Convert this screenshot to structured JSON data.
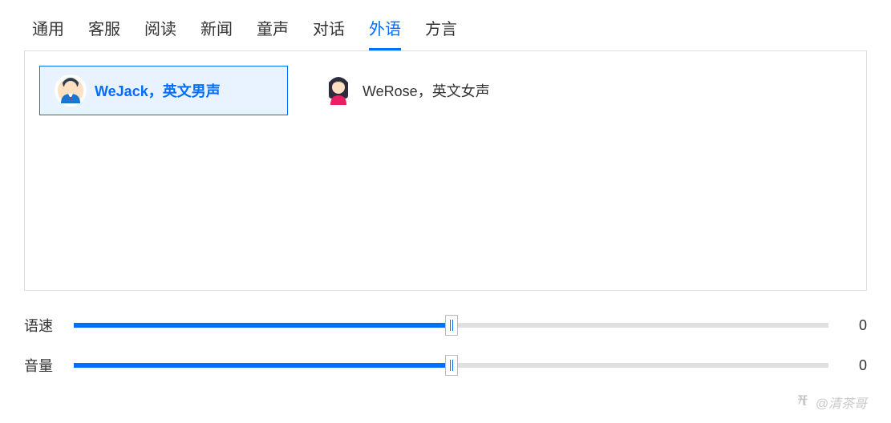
{
  "tabs": [
    {
      "label": "通用",
      "active": false
    },
    {
      "label": "客服",
      "active": false
    },
    {
      "label": "阅读",
      "active": false
    },
    {
      "label": "新闻",
      "active": false
    },
    {
      "label": "童声",
      "active": false
    },
    {
      "label": "对话",
      "active": false
    },
    {
      "label": "外语",
      "active": true
    },
    {
      "label": "方言",
      "active": false
    }
  ],
  "voices": [
    {
      "label": "WeJack，英文男声",
      "selected": true,
      "gender": "male"
    },
    {
      "label": "WeRose，英文女声",
      "selected": false,
      "gender": "female"
    }
  ],
  "sliders": {
    "speed": {
      "label": "语速",
      "percent": 50,
      "value": "0"
    },
    "volume": {
      "label": "音量",
      "percent": 50,
      "value": "0"
    }
  },
  "watermark": {
    "text": "@清茶哥"
  }
}
